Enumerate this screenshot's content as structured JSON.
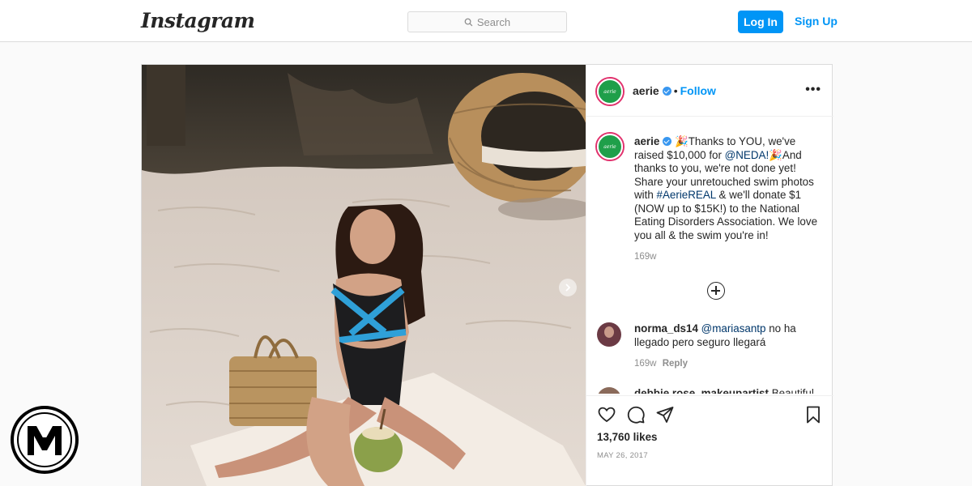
{
  "topbar": {
    "logo": "Instagram",
    "search_placeholder": "Search",
    "login_label": "Log In",
    "signup_label": "Sign Up"
  },
  "post": {
    "username": "aerie",
    "follow_label": "Follow",
    "more_label": "•••",
    "avatar_text": "aerie",
    "caption": {
      "username": "aerie",
      "emoji": "🎉",
      "part1": "Thanks to YOU, we've raised $10,000 for ",
      "mention": "@NEDA!",
      "part2": "And thanks to you, we're not done yet! Share your unretouched swim photos with ",
      "hashtag": "#AerieREAL",
      "part3": " & we'll donate $1 (NOW up to $15K!) to the National Eating Disorders Association. We love you all & the swim you're in!"
    },
    "caption_age": "169w",
    "comments": [
      {
        "username": "norma_ds14",
        "mention": "@mariasantp",
        "text": " no ha llegado pero seguro llegará",
        "age": "169w",
        "reply_label": "Reply"
      },
      {
        "username": "debbie.rose_makeupartist",
        "text": "Beautiful"
      }
    ],
    "likes": "13,760 likes",
    "date": "MAY 26, 2017"
  },
  "colors": {
    "accent": "#0095f6",
    "border": "#dbdbdb",
    "background": "#fafafa",
    "brand_green": "#1f9f4a"
  },
  "icons": [
    "search-icon",
    "verified-badge-icon",
    "more-options-icon",
    "next-arrow-icon",
    "load-more-comments-icon",
    "heart-icon",
    "comment-icon",
    "share-icon",
    "bookmark-icon",
    "watermark-logo"
  ]
}
